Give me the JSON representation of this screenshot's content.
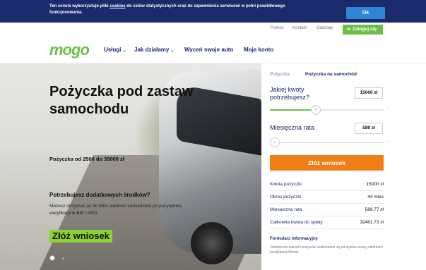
{
  "cookie_bar": {
    "text_before": "Ten serwis wykorzystuje pliki ",
    "link": "cookies",
    "text_after": " do celów statystycznych oraz do zapewnienia serwisowi w pełni prawidłowego funkcjonowania.",
    "ok_label": "Ok"
  },
  "util_nav": {
    "items": [
      "Pomoc",
      "Kontakt",
      "Oddziały"
    ],
    "login_label": "Zaloguj się"
  },
  "nav": {
    "logo": "mogo",
    "items": [
      {
        "label": "Usługi",
        "dropdown": true
      },
      {
        "label": "Jak działamy",
        "dropdown": true
      },
      {
        "label": "Wyceń swoje auto",
        "dropdown": false
      },
      {
        "label": "Moje konto",
        "dropdown": false
      }
    ]
  },
  "hero": {
    "title": "Pożyczka pod zastaw samochodu",
    "range": "Pożyczka od 2500 do 35000 zł",
    "question": "Potrzebujesz dodatkowych środków?",
    "description": "Możesz otrzymać aż do 85% wartości samochodu po pozytywnej weryfikacji w BIK i KRD.",
    "cta": "Złóż wniosek"
  },
  "calculator": {
    "tabs": [
      {
        "label": "Pożyczka",
        "active": false
      },
      {
        "label": "Pożyczka na samochód",
        "active": true
      }
    ],
    "amount_label": "Jakiej kwoty potrzebujesz?",
    "amount_value": "15000 zł",
    "amount_slider_fraction": 0.4,
    "rate_label": "Miesięczna rata",
    "rate_value": "589 zł",
    "rate_slider_fraction": 0.0,
    "submit_label": "Złóż wniosek",
    "summary": [
      {
        "label": "Kwota pożyczki",
        "value": "15000 zł"
      },
      {
        "label": "Okres pożyczki",
        "value": "44 mies"
      },
      {
        "label": "Miesięczna rata",
        "value": "588.77 zł"
      },
      {
        "label": "Całkowita kwota do spłaty",
        "value": "32461.73 zł"
      }
    ],
    "form_link": "Formularz informacyjny",
    "disclaimer": "Ostateczne warunki pożyczki uzależnione są od wyniku oceny zdolności kredytowej Klienta"
  },
  "colors": {
    "navy": "#1b2a6b",
    "green": "#6cc04a",
    "orange": "#f07e16",
    "ok_blue": "#2f86d4",
    "cta_green": "#8bd130"
  },
  "icons": {
    "login": "user-icon",
    "dropdown": "chevron-down-icon",
    "slider": "arrows-horizontal-icon"
  }
}
